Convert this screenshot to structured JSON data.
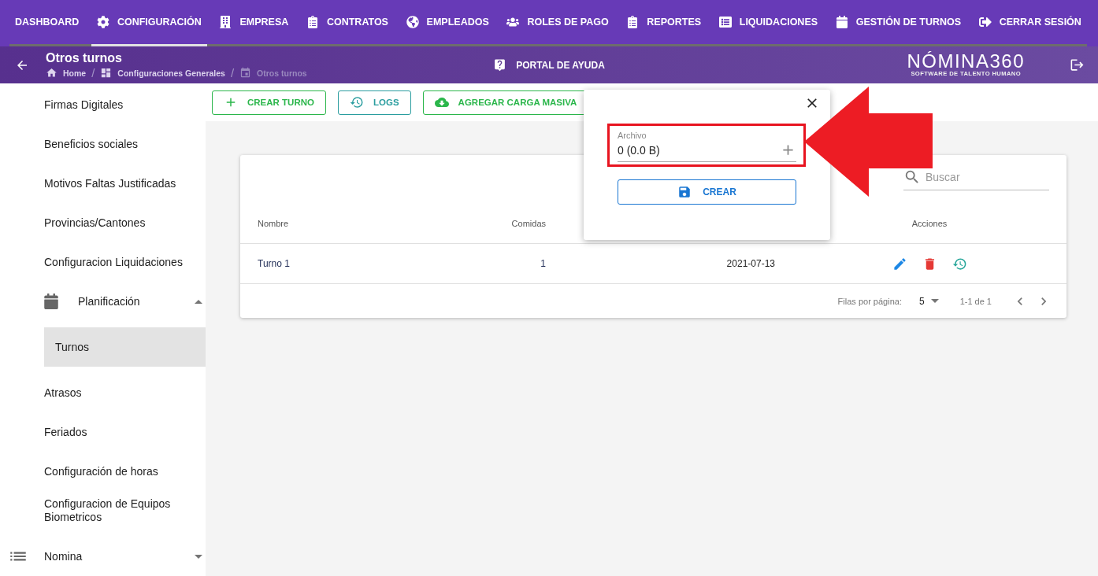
{
  "nav": {
    "tabs": [
      {
        "label": "DASHBOARD",
        "selected": false
      },
      {
        "label": "CONFIGURACIÓN",
        "selected": true
      },
      {
        "label": "EMPRESA",
        "selected": false
      },
      {
        "label": "CONTRATOS",
        "selected": false
      },
      {
        "label": "EMPLEADOS",
        "selected": false
      },
      {
        "label": "ROLES DE PAGO",
        "selected": false
      },
      {
        "label": "REPORTES",
        "selected": false
      },
      {
        "label": "LIQUIDACIONES",
        "selected": false
      },
      {
        "label": "GESTIÓN DE TURNOS",
        "selected": false
      },
      {
        "label": "CERRAR SESIÓN",
        "selected": false
      }
    ]
  },
  "page_header": {
    "title": "Otros turnos",
    "breadcrumbs": [
      {
        "label": "Home",
        "current": false
      },
      {
        "separator": "/",
        "label": "Configuraciones Generales",
        "current": false
      },
      {
        "separator": "/",
        "label": "Otros turnos",
        "current": true
      }
    ],
    "help_link": "PORTAL DE AYUDA",
    "logo": {
      "wordmark": "NÓMINA360",
      "tagline": "SOFTWARE DE TALENTO HUMANO"
    }
  },
  "sidebar": {
    "section_items": [
      {
        "kind": "link",
        "label": "Firmas Digitales",
        "selected": false
      },
      {
        "kind": "link",
        "label": "Beneficios sociales",
        "selected": false
      },
      {
        "kind": "link",
        "label": "Motivos Faltas Justificadas",
        "selected": false
      },
      {
        "kind": "link",
        "label": "Provincias/Cantones",
        "selected": false
      },
      {
        "kind": "link",
        "label": "Configuracion Liquidaciones",
        "selected": false
      },
      {
        "kind": "group",
        "label": "Planificación",
        "expanded": true,
        "children": [
          {
            "label": "Turnos",
            "selected": true
          }
        ]
      },
      {
        "kind": "link",
        "label": "Atrasos",
        "selected": false
      },
      {
        "kind": "link",
        "label": "Feriados",
        "selected": false
      },
      {
        "kind": "link",
        "label": "Configuración de horas",
        "selected": false
      },
      {
        "kind": "link",
        "label": "Configuracion de Equipos Biometricos",
        "selected": false
      }
    ],
    "groups": [
      {
        "label": "Nomina",
        "expanded": false
      }
    ]
  },
  "toolbar": {
    "buttons": [
      {
        "kind": "create",
        "label": "CREAR TURNO"
      },
      {
        "kind": "logs",
        "label": "LOGS"
      },
      {
        "kind": "upload",
        "label": "AGREGAR CARGA MASIVA"
      }
    ]
  },
  "table": {
    "search": {
      "placeholder": "Buscar"
    },
    "columns": [
      "Nombre",
      "Comidas"
    ],
    "actions_heading": "Acciones",
    "rows": [
      {
        "cells": [
          "Turno 1",
          "1",
          "2021-07-13"
        ]
      }
    ],
    "pagination": {
      "rows_per_page_label": "Filas por página:",
      "rows_per_page": "5",
      "range": "1-1 de 1"
    }
  },
  "dialog": {
    "field": {
      "label": "Archivo",
      "value": "0 (0.0 B)",
      "highlighted": true
    },
    "button": "CREAR"
  }
}
